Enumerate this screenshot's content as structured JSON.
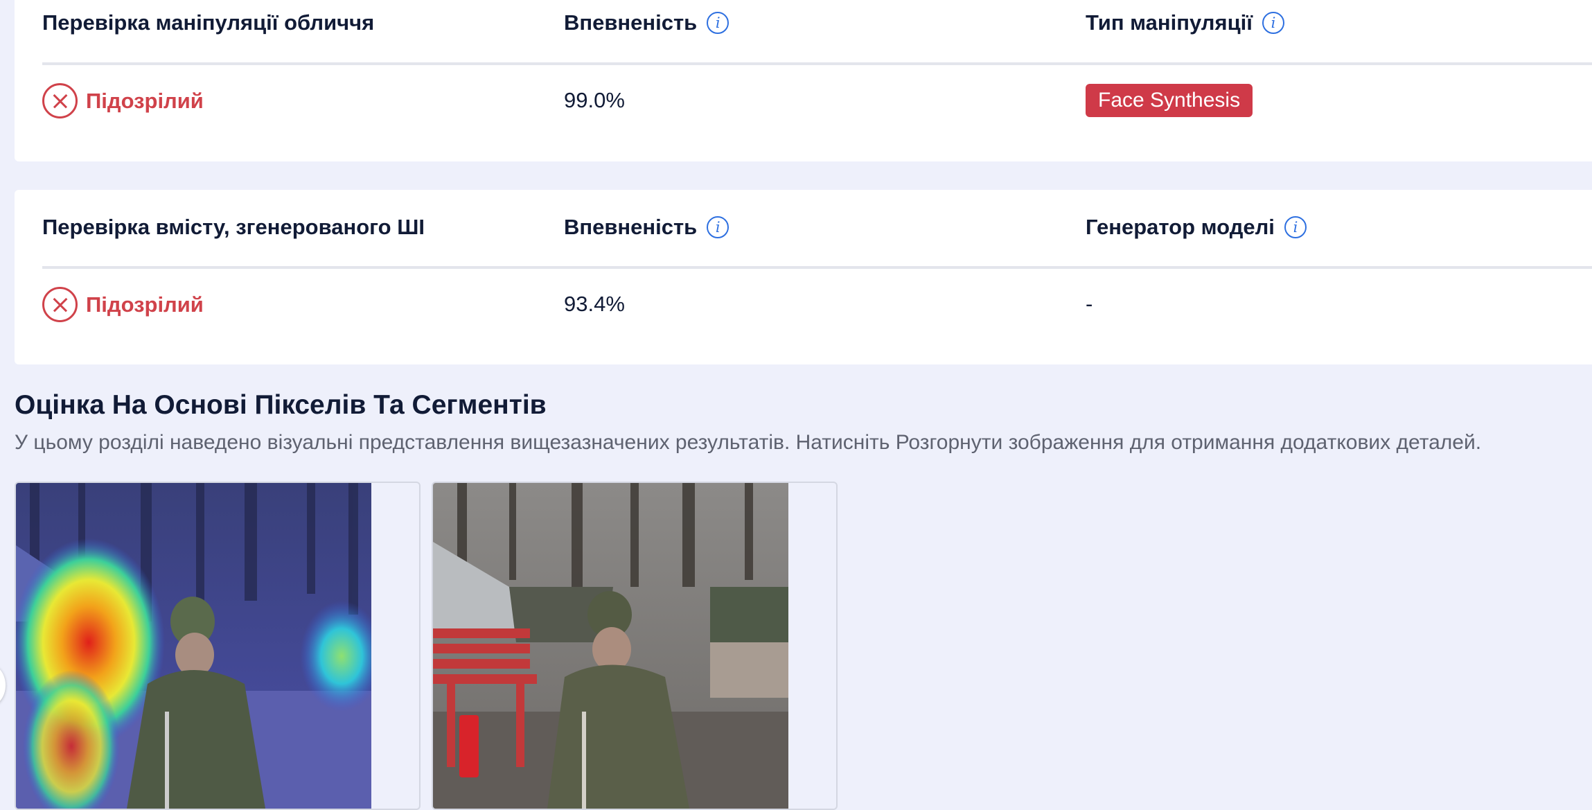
{
  "face_check": {
    "header": "Перевірка маніпуляції обличчя",
    "confidence_header": "Впевненість",
    "type_header": "Тип маніпуляції",
    "status": "Підозрілий",
    "confidence": "99.0%",
    "type_badge": "Face Synthesis",
    "badge_color": "#cf3a48"
  },
  "ai_check": {
    "header": "Перевірка вмісту, згенерованого ШІ",
    "confidence_header": "Впевненість",
    "generator_header": "Генератор моделі",
    "status": "Підозрілий",
    "confidence": "93.4%",
    "generator": "-"
  },
  "pixel_section": {
    "title": "Оцінка На Основі Пікселів Та Сегментів",
    "description": "У цьому розділі наведено візуальні представлення вищезазначених результатів. Натисніть Розгорнути зображення для отримання додаткових деталей."
  },
  "icons": {
    "info": "info-icon",
    "status": "x-circle-icon"
  },
  "colors": {
    "suspicious": "#d0424a",
    "accent": "#2d6fe0",
    "background": "#eef0fb"
  }
}
